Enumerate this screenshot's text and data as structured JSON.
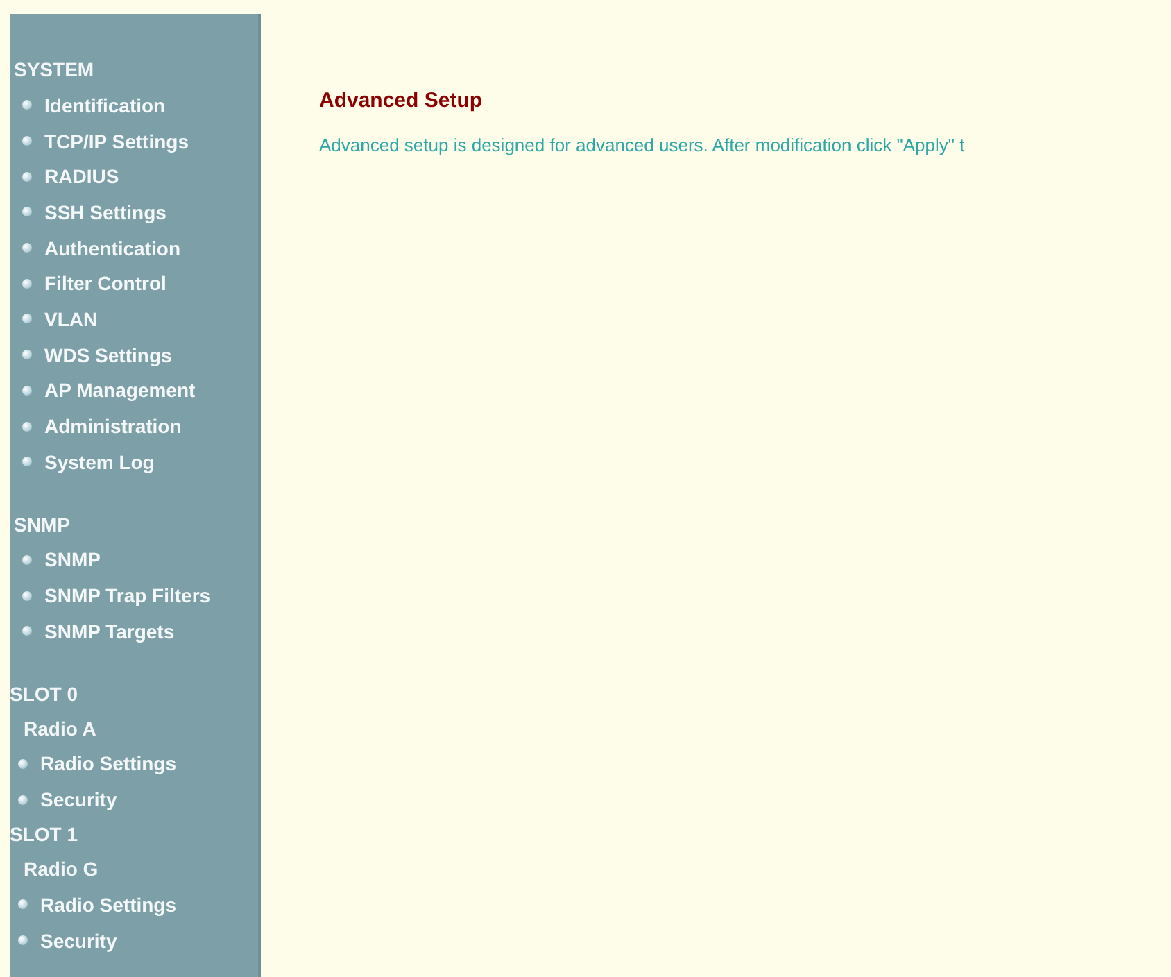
{
  "sidebar": {
    "sections": [
      {
        "kind": "group",
        "title": "SYSTEM",
        "entries": [
          {
            "kind": "link",
            "label": "Identification"
          },
          {
            "kind": "link",
            "label": "TCP/IP Settings"
          },
          {
            "kind": "link",
            "label": "RADIUS"
          },
          {
            "kind": "link",
            "label": "SSH Settings"
          },
          {
            "kind": "link",
            "label": "Authentication"
          },
          {
            "kind": "link",
            "label": "Filter Control"
          },
          {
            "kind": "link",
            "label": "VLAN"
          },
          {
            "kind": "link",
            "label": "WDS Settings"
          },
          {
            "kind": "link",
            "label": "AP Management"
          },
          {
            "kind": "link",
            "label": "Administration"
          },
          {
            "kind": "link",
            "label": "System Log"
          }
        ]
      },
      {
        "kind": "group",
        "title": "SNMP",
        "entries": [
          {
            "kind": "link",
            "label": "SNMP"
          },
          {
            "kind": "link",
            "label": "SNMP Trap Filters"
          },
          {
            "kind": "link",
            "label": "SNMP Targets"
          }
        ]
      },
      {
        "kind": "slot",
        "title": "SLOT 0",
        "entries": [
          {
            "kind": "subheading",
            "label": "Radio A"
          },
          {
            "kind": "link",
            "label": "Radio Settings"
          },
          {
            "kind": "link",
            "label": "Security"
          }
        ]
      },
      {
        "kind": "slot",
        "title": "SLOT 1",
        "entries": [
          {
            "kind": "subheading",
            "label": "Radio G"
          },
          {
            "kind": "link",
            "label": "Radio Settings"
          },
          {
            "kind": "link",
            "label": "Security"
          }
        ]
      }
    ]
  },
  "main": {
    "title": "Advanced Setup",
    "description": "Advanced setup is designed for advanced users. After modification click \"Apply\" t"
  }
}
